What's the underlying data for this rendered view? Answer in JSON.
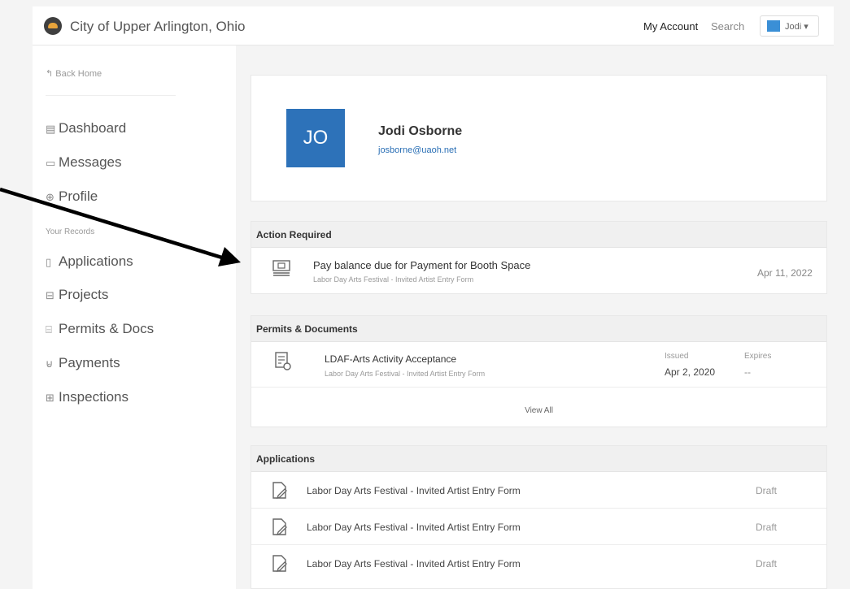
{
  "header": {
    "site_title": "City of Upper Arlington, Ohio",
    "my_account": "My Account",
    "search": "Search",
    "user_short": "Jodi ▾"
  },
  "sidebar": {
    "back": "↰ Back Home",
    "items": [
      {
        "icon": "▤",
        "label": "Dashboard"
      },
      {
        "icon": "▭",
        "label": "Messages"
      },
      {
        "icon": "⊕",
        "label": "Profile"
      }
    ],
    "records_heading": "Your Records",
    "records": [
      {
        "icon": "▯",
        "label": "Applications"
      },
      {
        "icon": "⊟",
        "label": "Projects"
      },
      {
        "icon": "⌸",
        "label": "Permits & Docs"
      },
      {
        "icon": "⊌",
        "label": "Payments"
      },
      {
        "icon": "⊞",
        "label": "Inspections"
      }
    ]
  },
  "profile": {
    "initials": "JO",
    "name": "Jodi Osborne",
    "email": "josborne@uaoh.net"
  },
  "action_required": {
    "heading": "Action Required",
    "title": "Pay balance due for Payment for Booth Space",
    "subtitle": "Labor Day Arts Festival - Invited Artist Entry Form",
    "date": "Apr 11, 2022"
  },
  "permits": {
    "heading": "Permits & Documents",
    "title": "LDAF-Arts Activity Acceptance",
    "subtitle": "Labor Day Arts Festival - Invited Artist Entry Form",
    "issued_label": "Issued",
    "issued_value": "Apr 2, 2020",
    "expires_label": "Expires",
    "expires_value": "--",
    "view_all": "View All"
  },
  "applications": {
    "heading": "Applications",
    "rows": [
      {
        "title": "Labor Day Arts Festival - Invited Artist Entry Form",
        "status": "Draft"
      },
      {
        "title": "Labor Day Arts Festival - Invited Artist Entry Form",
        "status": "Draft"
      },
      {
        "title": "Labor Day Arts Festival - Invited Artist Entry Form",
        "status": "Draft"
      }
    ]
  }
}
